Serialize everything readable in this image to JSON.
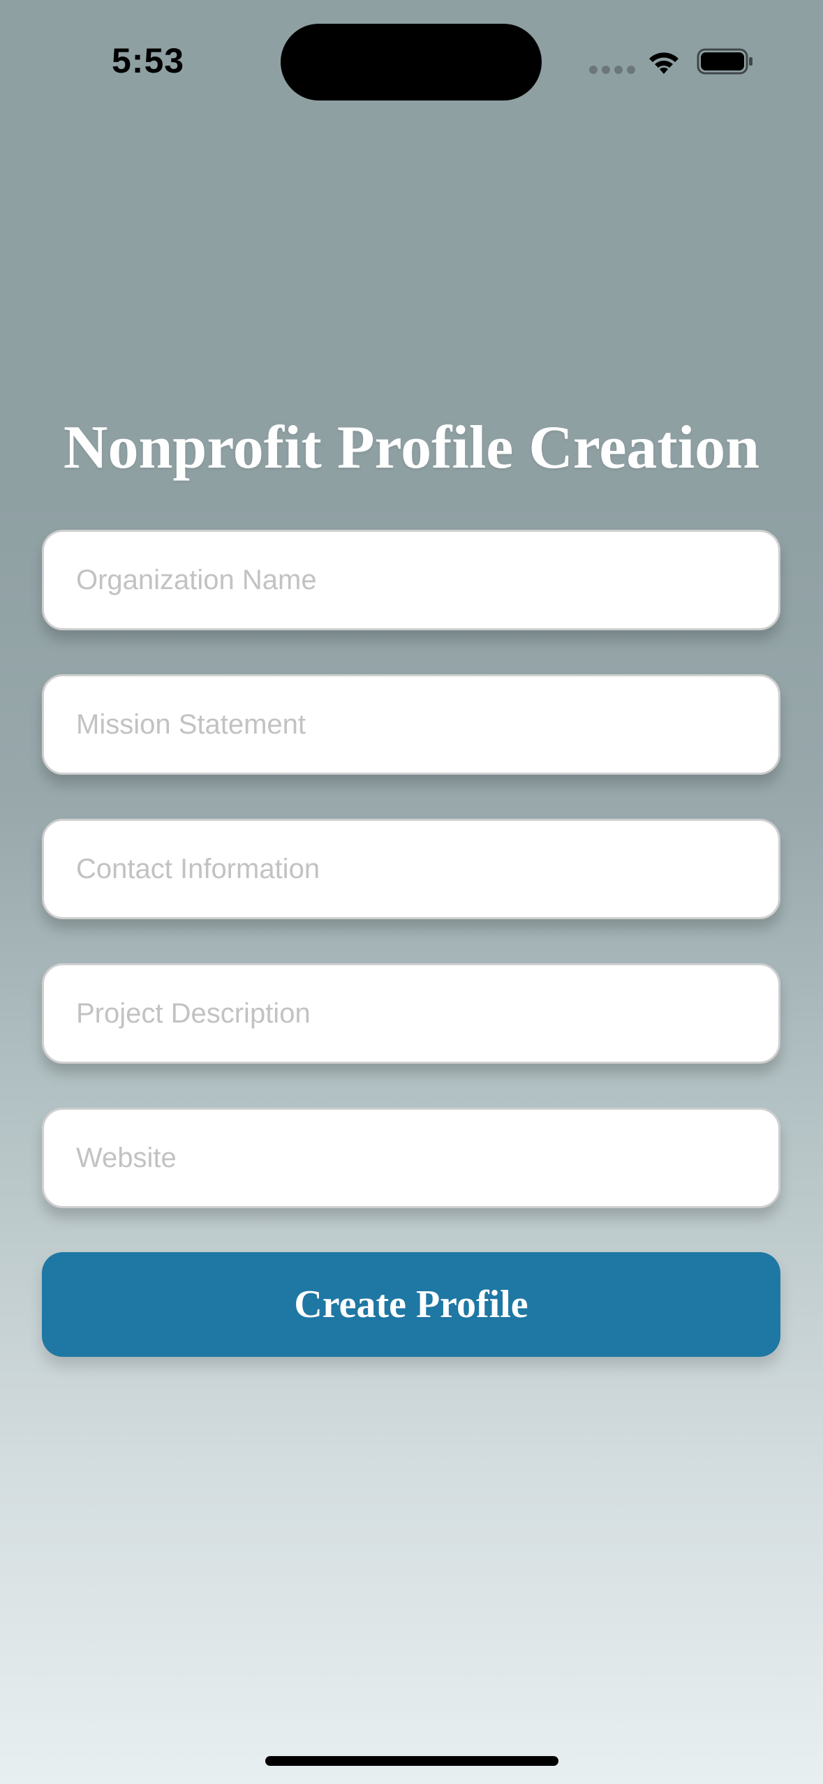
{
  "status_bar": {
    "time": "5:53"
  },
  "page": {
    "title": "Nonprofit Profile Creation"
  },
  "form": {
    "fields": [
      {
        "placeholder": "Organization Name",
        "value": ""
      },
      {
        "placeholder": "Mission Statement",
        "value": ""
      },
      {
        "placeholder": "Contact Information",
        "value": ""
      },
      {
        "placeholder": "Project Description",
        "value": ""
      },
      {
        "placeholder": "Website",
        "value": ""
      }
    ],
    "submit_label": "Create Profile"
  },
  "colors": {
    "accent": "#1f77a3",
    "background_top": "#8fa0a3",
    "background_bottom": "#e8eff1",
    "title_text": "#ffffff",
    "placeholder_text": "#c2c2c2"
  }
}
